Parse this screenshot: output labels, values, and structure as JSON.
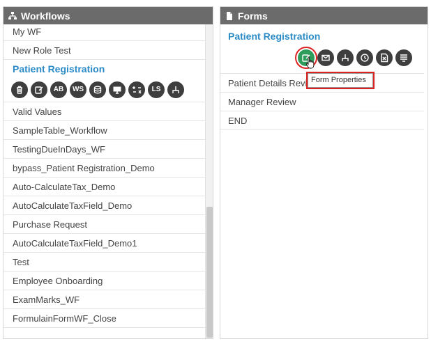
{
  "colors": {
    "header_bg": "#6b6b6b",
    "accent": "#2b8bc6",
    "icon_bg": "#3e3e3e",
    "active_icon_bg": "#2e9c5a",
    "highlight": "#dd2222"
  },
  "workflows": {
    "title": "Workflows",
    "header_icon": "sitemap-icon",
    "items_before": [
      "My WF",
      "New Role Test"
    ],
    "selected": "Patient Registration",
    "toolbar": [
      {
        "icon": "trash-icon",
        "text": ""
      },
      {
        "icon": "edit-icon",
        "text": ""
      },
      {
        "icon": "ab-icon",
        "text": "AB"
      },
      {
        "icon": "ws-icon",
        "text": "WS"
      },
      {
        "icon": "database-icon",
        "text": ""
      },
      {
        "icon": "monitor-icon",
        "text": ""
      },
      {
        "icon": "plus-minus-formula-icon",
        "text": ""
      },
      {
        "icon": "ls-icon",
        "text": "LS"
      },
      {
        "icon": "workflow-branch-icon",
        "text": ""
      }
    ],
    "items_after": [
      "Valid Values",
      "SampleTable_Workflow",
      "TestingDueInDays_WF",
      "bypass_Patient Registration_Demo",
      "Auto-CalculateTax_Demo",
      "AutoCalculateTaxField_Demo",
      "Purchase Request",
      "AutoCalculateTaxField_Demo1",
      "Test",
      "Employee Onboarding",
      "ExamMarks_WF",
      "FormulainFormWF_Close"
    ]
  },
  "forms": {
    "title": "Forms",
    "header_icon": "document-icon",
    "selected": "Patient Registration",
    "toolbar": [
      "form-properties-icon",
      "email-icon",
      "branch-icon",
      "clock-icon",
      "excel-icon",
      "list-icon"
    ],
    "items": [
      "Patient Details Revi",
      "Manager Review",
      "END"
    ],
    "tooltip": "Form Properties"
  }
}
